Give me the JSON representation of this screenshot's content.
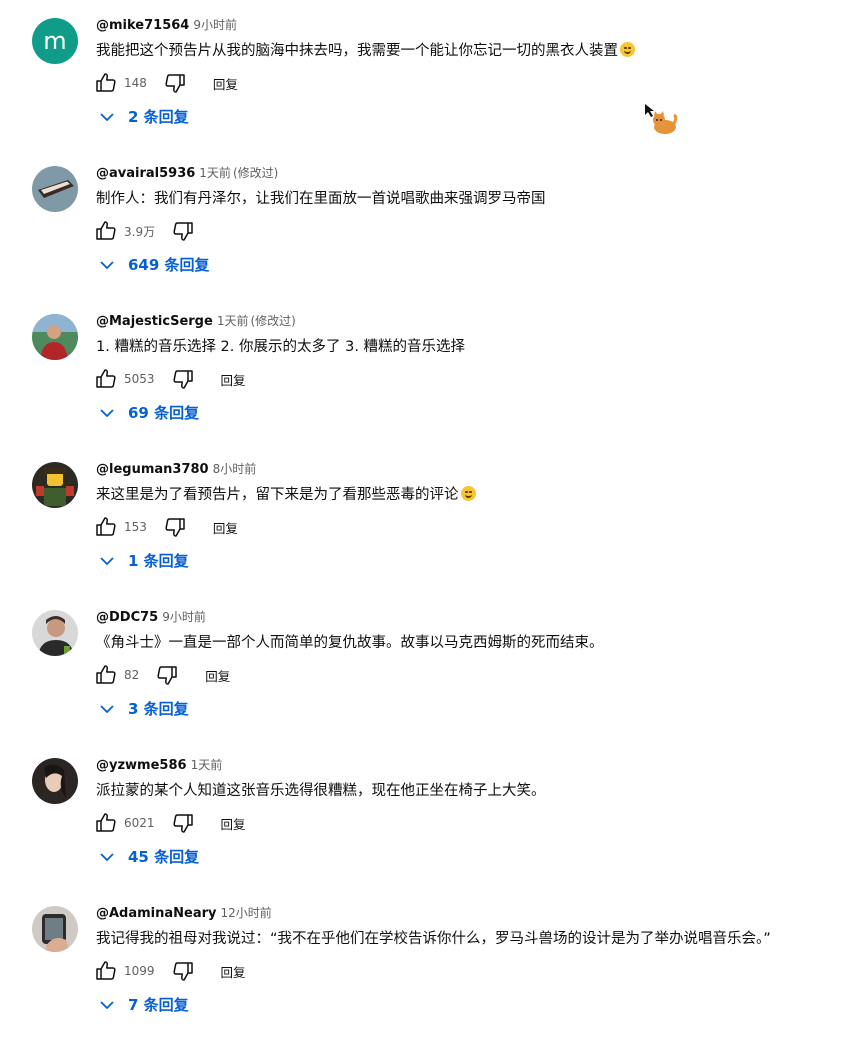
{
  "comments": [
    {
      "handle": "@mike71564",
      "time": "9小时前",
      "edited": "",
      "text": "我能把这个预告片从我的脑海中抹去吗，我需要一个能让你忘记一切的黑衣人装置",
      "emoji": "laughing-emoji",
      "likes": "148",
      "reply": "回复",
      "replies": "2 条回复"
    },
    {
      "handle": "@avairal5936",
      "time": "1天前",
      "edited": "(修改过)",
      "text": "制作人：我们有丹泽尔，让我们在里面放一首说唱歌曲来强调罗马帝国",
      "emoji": "",
      "likes": "3.9万",
      "reply": "",
      "replies": "649 条回复"
    },
    {
      "handle": "@MajesticSerge",
      "time": "1天前",
      "edited": "(修改过)",
      "text": "1. 糟糕的音乐选择 2. 你展示的太多了 3. 糟糕的音乐选择",
      "emoji": "",
      "likes": "5053",
      "reply": "回复",
      "replies": "69 条回复"
    },
    {
      "handle": "@leguman3780",
      "time": "8小时前",
      "edited": "",
      "text": "来这里是为了看预告片，留下来是为了看那些恶毒的评论",
      "emoji": "grinning-emoji",
      "likes": "153",
      "reply": "回复",
      "replies": "1 条回复"
    },
    {
      "handle": "@DDC75",
      "time": "9小时前",
      "edited": "",
      "text": "《角斗士》一直是一部个人而简单的复仇故事。故事以马克西姆斯的死而结束。",
      "emoji": "",
      "likes": "82",
      "reply": "回复",
      "replies": "3 条回复"
    },
    {
      "handle": "@yzwme586",
      "time": "1天前",
      "edited": "",
      "text": "派拉蒙的某个人知道这张音乐选得很糟糕，现在他正坐在椅子上大笑。",
      "emoji": "",
      "likes": "6021",
      "reply": "回复",
      "replies": "45 条回复"
    },
    {
      "handle": "@AdaminaNeary",
      "time": "12小时前",
      "edited": "",
      "text": "我记得我的祖母对我说过：“我不在乎他们在学校告诉你什么，罗马斗兽场的设计是为了举办说唱音乐会。”",
      "emoji": "",
      "likes": "1099",
      "reply": "回复",
      "replies": "7 条回复"
    }
  ],
  "avatars": [
    "letter-m-avatar",
    "keyboard-avatar",
    "person-outdoor-avatar",
    "lego-figure-avatar",
    "man-portrait-avatar",
    "woman-portrait-avatar",
    "hand-photo-avatar"
  ],
  "avatar_letter": "m",
  "colors": {
    "accent": "#065fd4",
    "avatar_m": "#0f9d8a",
    "meta": "#606060"
  }
}
